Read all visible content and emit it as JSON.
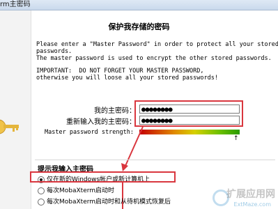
{
  "window": {
    "title": "rm主密码"
  },
  "dialog": {
    "heading": "保护我存储的密码",
    "intro_lines": [
      "Please enter a \"Master Password\" in order to protect all your stored",
      "passwords.",
      "The master password is used to encrypt the other stored passwords."
    ],
    "warning_lines": [
      "IMPORTANT:  DO NOT FORGET YOUR MASTER PASSWORD,",
      "otherwise you will loose all your stored passwords!"
    ],
    "password_label": "我的主密码：",
    "password_value": "●●●●●●●●",
    "confirm_label": "重新输入我的主密码：",
    "confirm_value": "●●●●●●●●",
    "strength_label": "Master password strength:",
    "strength_level": 1.0,
    "strength_arrow": "↑"
  },
  "prompt_section": {
    "title": "提示我输入主密码",
    "options": [
      {
        "label": "仅在新的Windows帐户或新计算机上",
        "selected": true
      },
      {
        "label": "每次MobaXterm启动时",
        "selected": false
      },
      {
        "label": "每次MobaXterm启动时和从待机模式恢复后",
        "selected": false
      }
    ]
  },
  "watermark": {
    "text": "扩展应用网",
    "sub": "ExtMaze.com"
  },
  "colors": {
    "highlight": "#d9363e",
    "titlebar": "#c9d9ec"
  }
}
